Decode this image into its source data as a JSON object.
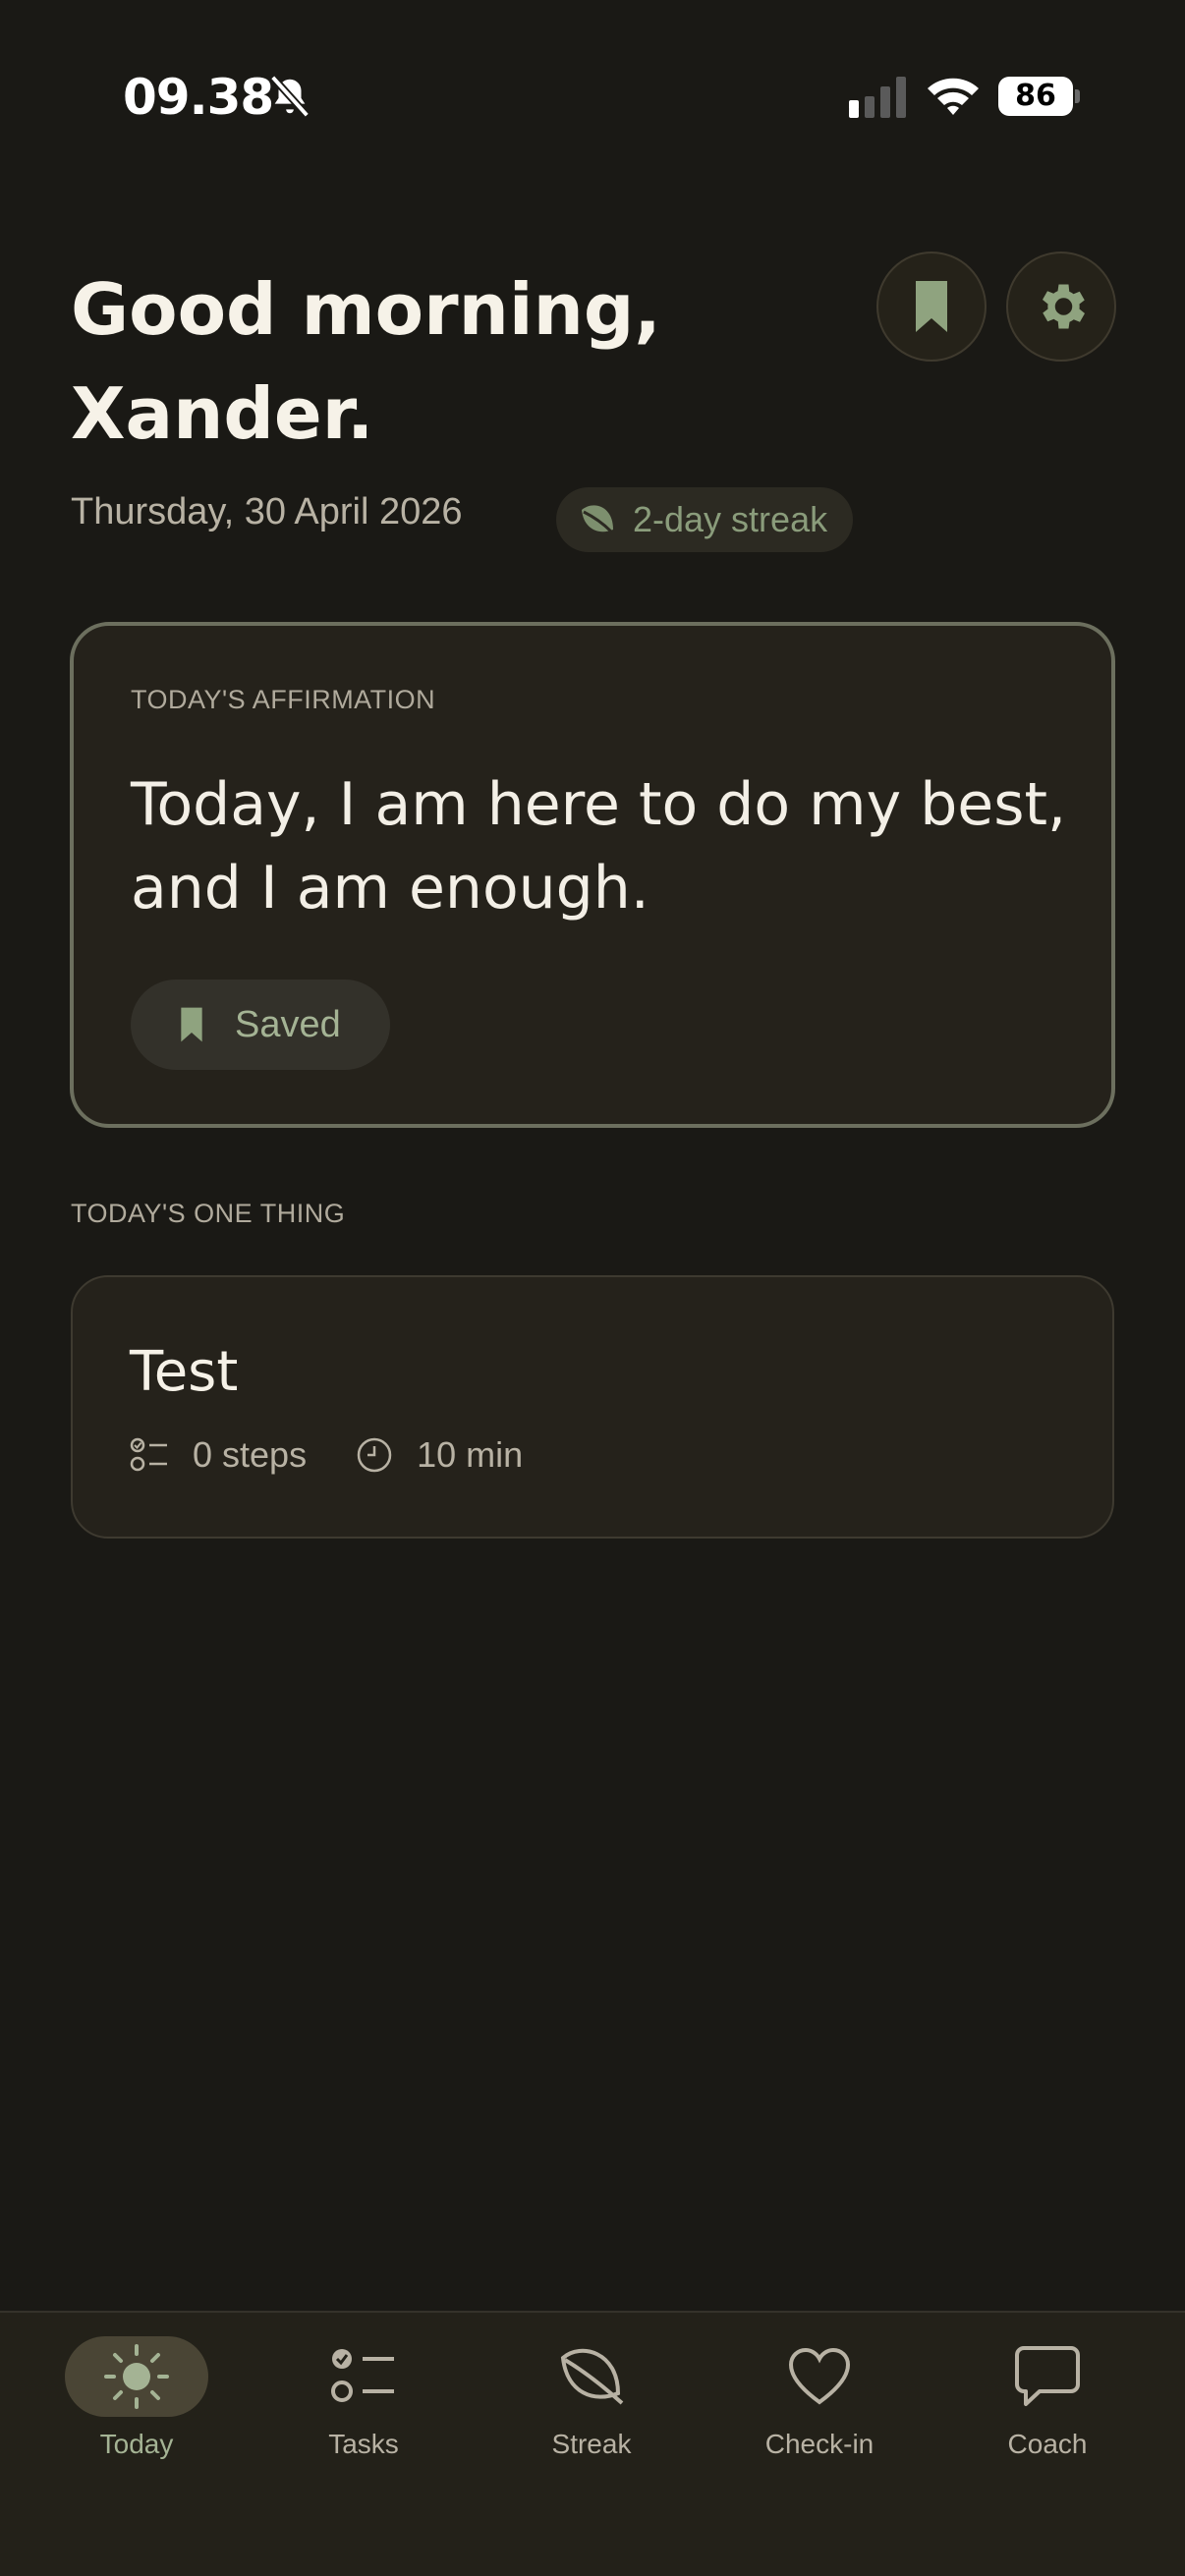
{
  "status_bar": {
    "time": "09.38",
    "battery": "86"
  },
  "header": {
    "greeting_line1": "Good morning,",
    "greeting_line2": "Xander.",
    "date": "Thursday, 30 April 2026",
    "streak_label": "2-day streak"
  },
  "affirmation": {
    "section_label": "TODAY'S AFFIRMATION",
    "text": "Today, I am here to do my best, and I am enough.",
    "saved_label": "Saved"
  },
  "one_thing": {
    "section_label": "TODAY'S ONE THING",
    "task_title": "Test",
    "steps": "0 steps",
    "duration": "10 min"
  },
  "nav": {
    "items": [
      {
        "label": "Today",
        "icon": "sun-icon",
        "active": true
      },
      {
        "label": "Tasks",
        "icon": "checklist-icon",
        "active": false
      },
      {
        "label": "Streak",
        "icon": "leaf-icon",
        "active": false
      },
      {
        "label": "Check-in",
        "icon": "heart-icon",
        "active": false
      },
      {
        "label": "Coach",
        "icon": "chat-bubble-icon",
        "active": false
      }
    ]
  },
  "colors": {
    "background": "#1a1915",
    "card": "#25221b",
    "accent_green": "#a4b394",
    "text_primary": "#f3efe6",
    "text_secondary": "#b8b2a4"
  }
}
